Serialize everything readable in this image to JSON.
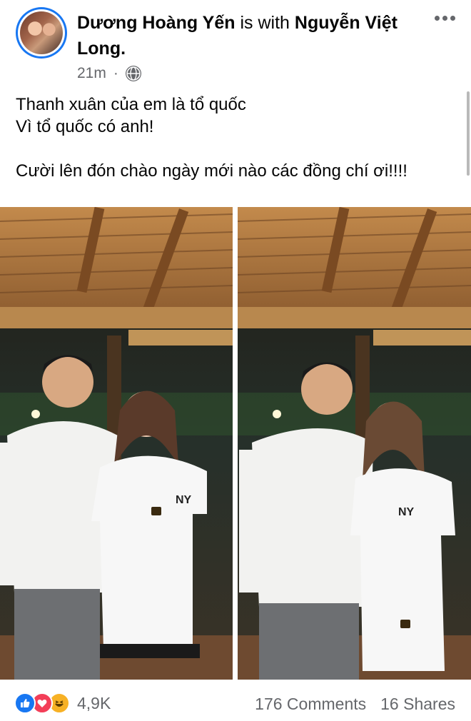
{
  "post": {
    "author": "Dương Hoàng Yến",
    "with_text": "is with",
    "tagged": "Nguyễn Việt Long.",
    "time": "21m",
    "privacy_icon": "globe-icon",
    "more_icon": "more-options-icon",
    "text_lines": [
      "Thanh xuân của em là tổ quốc",
      "Vì tổ quốc có anh!",
      "",
      "Cười lên đón chào ngày mới nào các đồng chí ơi!!!!"
    ]
  },
  "photos": [
    {
      "name": "photo-1"
    },
    {
      "name": "photo-2"
    }
  ],
  "footer": {
    "reaction_icons": [
      "like-icon",
      "love-icon",
      "haha-icon"
    ],
    "reaction_count": "4,9K",
    "comments": "176 Comments",
    "shares": "16 Shares"
  },
  "colors": {
    "link_blue": "#1877f2",
    "secondary_text": "#65676b",
    "love_red": "#f33e58",
    "haha_yellow": "#f7b125"
  }
}
